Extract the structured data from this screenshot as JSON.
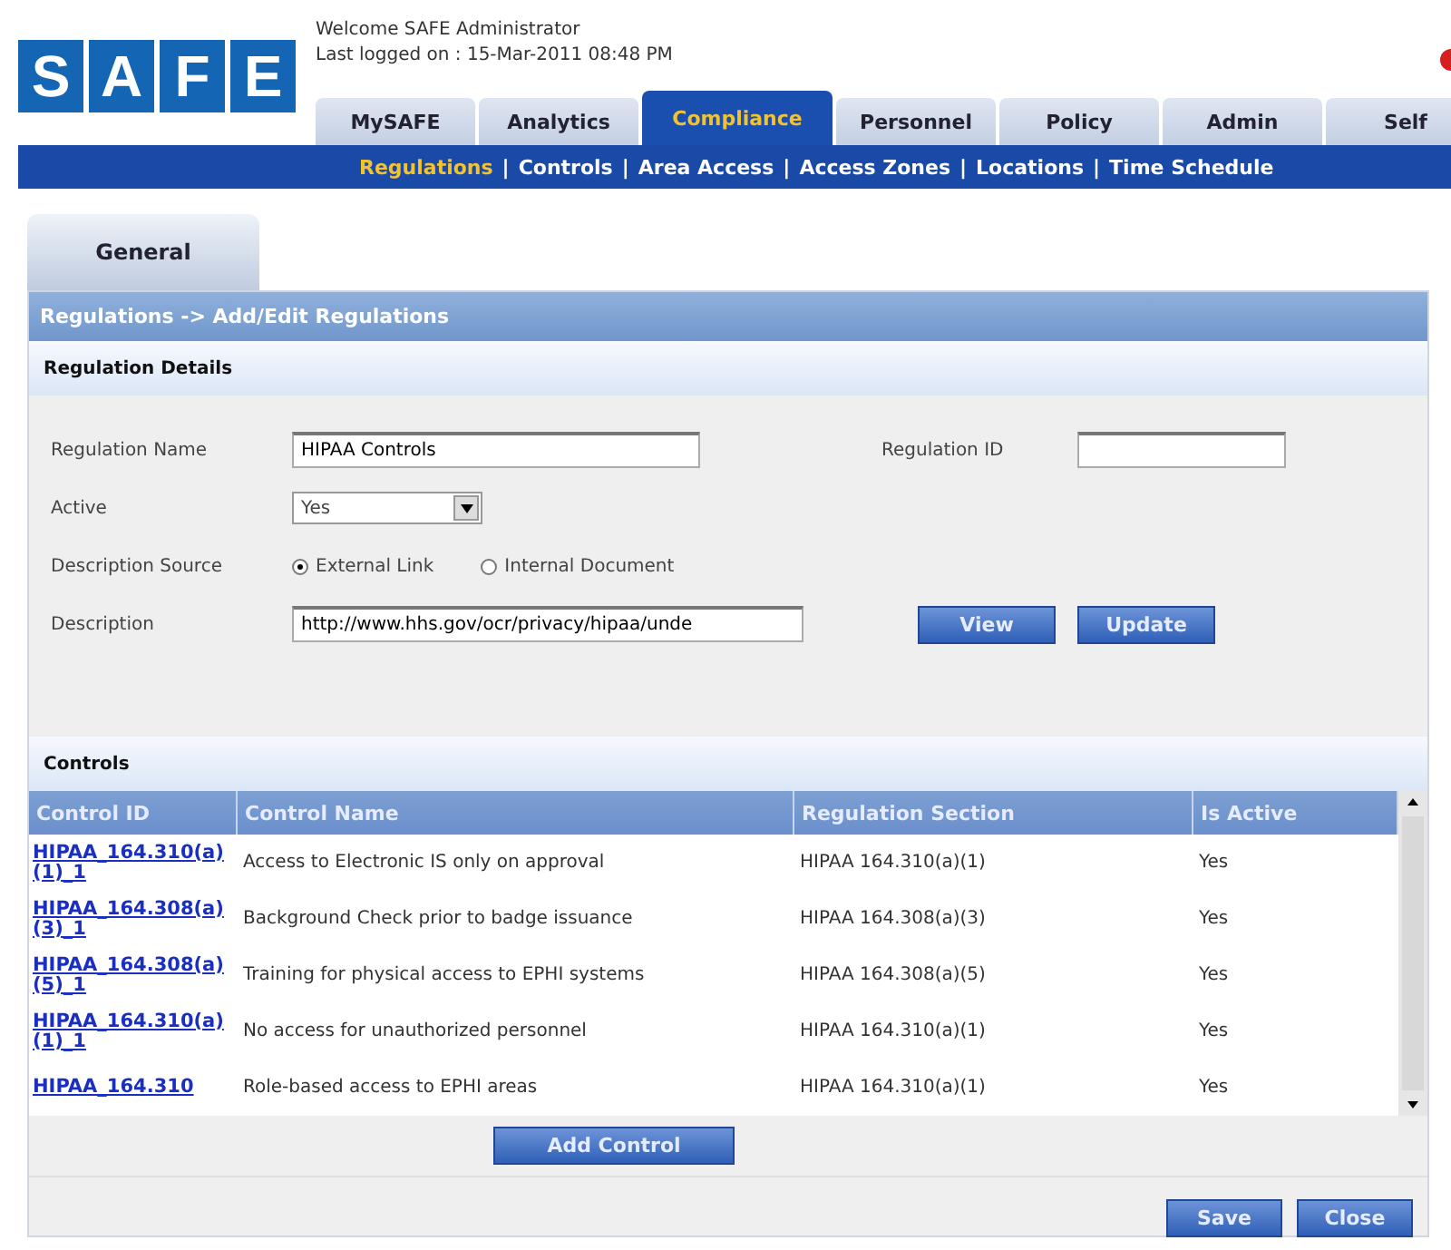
{
  "header": {
    "logo_letters": [
      "S",
      "A",
      "F",
      "E"
    ],
    "welcome": "Welcome SAFE Administrator",
    "last_logged": "Last logged on : 15-Mar-2011 08:48 PM"
  },
  "main_tabs": [
    {
      "label": "MySAFE",
      "selected": false
    },
    {
      "label": "Analytics",
      "selected": false
    },
    {
      "label": "Compliance",
      "selected": true
    },
    {
      "label": "Personnel",
      "selected": false
    },
    {
      "label": "Policy",
      "selected": false
    },
    {
      "label": "Admin",
      "selected": false
    },
    {
      "label": "Self",
      "selected": false
    }
  ],
  "sub_nav": {
    "separator": "|",
    "items": [
      {
        "label": "Regulations",
        "selected": true
      },
      {
        "label": "Controls",
        "selected": false
      },
      {
        "label": "Area Access",
        "selected": false
      },
      {
        "label": "Access Zones",
        "selected": false
      },
      {
        "label": "Locations",
        "selected": false
      },
      {
        "label": "Time Schedule",
        "selected": false
      }
    ]
  },
  "page_tabs": [
    {
      "label": "General",
      "selected": true
    }
  ],
  "breadcrumb": "Regulations -> Add/Edit Regulations",
  "details": {
    "title": "Regulation Details",
    "name": {
      "label": "Regulation Name",
      "value": "HIPAA Controls"
    },
    "id": {
      "label": "Regulation ID"
    },
    "active": {
      "label": "Active",
      "value": "Yes"
    },
    "source": {
      "label": "Description Source",
      "options": [
        {
          "label": "External Link",
          "selected": true
        },
        {
          "label": "Internal Document",
          "selected": false
        }
      ]
    },
    "description": {
      "label": "Description",
      "value": "http://www.hhs.gov/ocr/privacy/hipaa/unde"
    },
    "buttons": [
      "View",
      "Update"
    ]
  },
  "controls": {
    "title": "Controls",
    "columns": [
      "Control ID",
      "Control Name",
      "Regulation Section",
      "Is Active"
    ],
    "rows": [
      {
        "id": "HIPAA_164.310(a)(1)_1",
        "name": "Access to Electronic IS only on approval",
        "section": "HIPAA 164.310(a)(1)",
        "active": "Yes"
      },
      {
        "id": "HIPAA_164.308(a)(3)_1",
        "name": "Background Check prior to badge issuance",
        "section": "HIPAA 164.308(a)(3)",
        "active": "Yes"
      },
      {
        "id": "HIPAA_164.308(a)(5)_1",
        "name": "Training for physical access to EPHI systems",
        "section": "HIPAA 164.308(a)(5)",
        "active": "Yes"
      },
      {
        "id": "HIPAA_164.310(a)(1)_1",
        "name": "No access for unauthorized personnel",
        "section": "HIPAA 164.310(a)(1)",
        "active": "Yes"
      },
      {
        "id": "HIPAA_164.310",
        "name": "Role-based access to EPHI areas",
        "section": "HIPAA 164.310(a)(1)",
        "active": "Yes"
      }
    ],
    "add_button": "Add Control"
  },
  "footer_buttons": [
    "Save",
    "Close"
  ]
}
